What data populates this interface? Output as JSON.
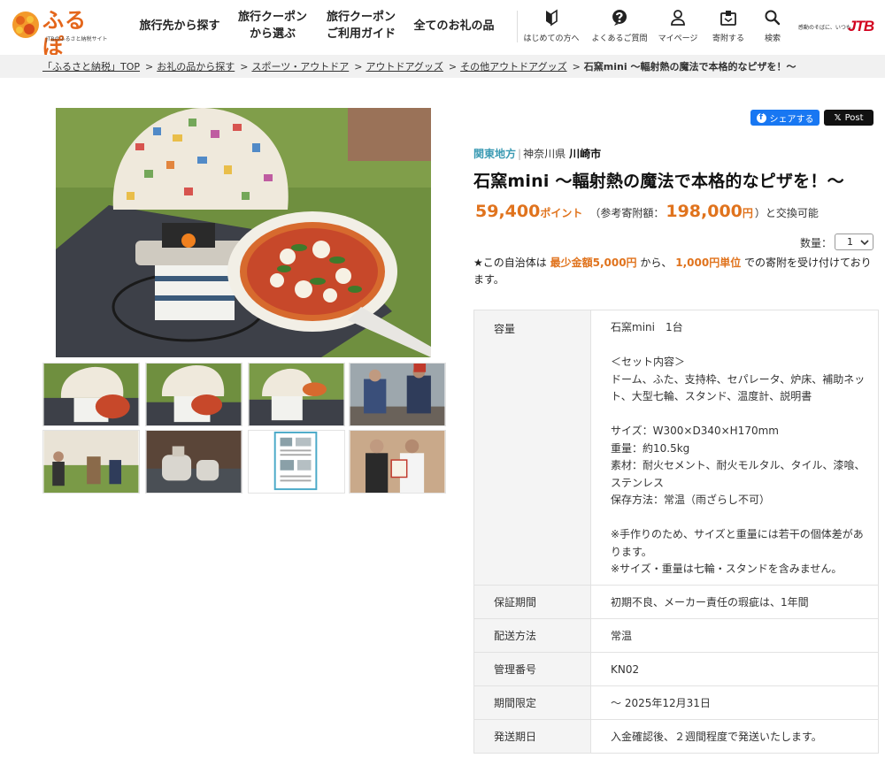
{
  "header": {
    "logo_text": "ふるぽ",
    "logo_sub": "JTBのふるさと納税サイト",
    "nav": [
      {
        "label": "旅行先から探す"
      },
      {
        "label": "旅行クーポン\nから選ぶ"
      },
      {
        "label": "旅行クーポン\nご利用ガイド"
      },
      {
        "label": "全てのお礼の品"
      }
    ],
    "icons": [
      {
        "label": "はじめての方へ",
        "icon": "beginner-mark-icon"
      },
      {
        "label": "よくあるご質問",
        "icon": "question-icon"
      },
      {
        "label": "マイページ",
        "icon": "user-icon"
      },
      {
        "label": "寄附する",
        "icon": "donate-box-icon"
      },
      {
        "label": "検索",
        "icon": "search-icon"
      }
    ],
    "jtb_tagline": "感動のそばに、いつも。",
    "jtb_logo": "JTB"
  },
  "breadcrumb": {
    "links": [
      "「ふるさと納税」TOP",
      "お礼の品から探す",
      "スポーツ・アウトドア",
      "アウトドアグッズ",
      "その他アウトドアグッズ"
    ],
    "current": "石窯mini 〜輻射熱の魔法で本格的なピザを！〜"
  },
  "share": {
    "facebook": "シェアする",
    "x": "Post"
  },
  "product": {
    "region": "関東地方",
    "prefecture": "神奈川県",
    "city": "川崎市",
    "title": "石窯mini 〜輻射熱の魔法で本格的なピザを！〜",
    "points": "59,400",
    "points_unit": "ポイント",
    "ref_label": "（参考寄附額：",
    "ref_amount": "198,000",
    "ref_unit": "円",
    "ref_tail": "）と交換可能",
    "qty_label": "数量：",
    "qty_value": "1",
    "notice_prefix": "★この自治体は",
    "notice_min": "最少金額5,000円",
    "notice_mid": "から、",
    "notice_unit": "1,000円単位",
    "notice_suffix": "での寄附を受け付けております。"
  },
  "specs": [
    {
      "key": "容量",
      "value": "石窯mini　1台\n\n＜セット内容＞\nドーム、ふた、支持枠、セパレータ、炉床、補助ネット、大型七輪、スタンド、温度計、説明書\n\nサイズ：W300×D340×H170mm\n重量：約10.5kg\n素材：耐火セメント、耐火モルタル、タイル、漆喰、ステンレス\n保存方法：常温（雨ざらし不可）\n\n※手作りのため、サイズと重量には若干の個体差があります。\n※サイズ・重量は七輪・スタンドを含みません。"
    },
    {
      "key": "保証期間",
      "value": "初期不良、メーカー責任の瑕疵は、1年間"
    },
    {
      "key": "配送方法",
      "value": "常温"
    },
    {
      "key": "管理番号",
      "value": "KN02"
    },
    {
      "key": "期間限定",
      "value": "〜 2025年12月31日"
    },
    {
      "key": "発送期日",
      "value": "入金確認後、２週間程度で発送いたします。"
    }
  ],
  "colors": {
    "accent_orange": "#e0731d",
    "region_link": "#3a9ab3",
    "facebook": "#1877f2",
    "jtb_red": "#d2001e"
  }
}
